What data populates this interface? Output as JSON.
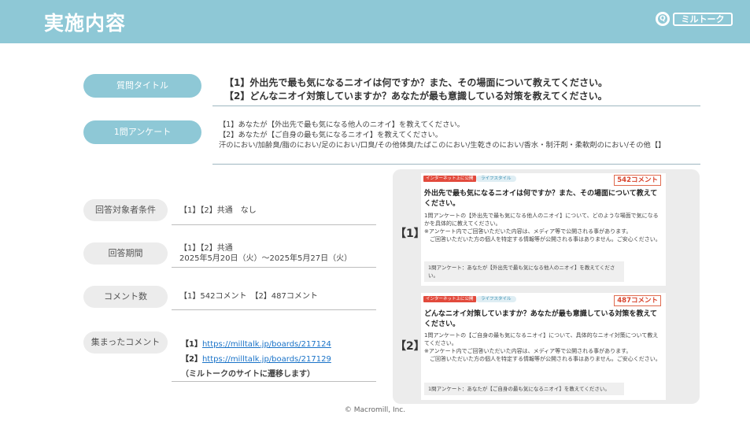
{
  "header": {
    "title": "実施内容",
    "logo_mark": "Q",
    "logo_text": "ミルトーク"
  },
  "labels": {
    "question_title": "質問タイトル",
    "survey": "1問アンケート",
    "target": "回答対象者条件",
    "period": "回答期間",
    "comments": "コメント数",
    "collected": "集まったコメント"
  },
  "question_title": {
    "line1": "【1】外出先で最も気になるニオイは何ですか？また、その場面について教えてください。",
    "line2": "【2】どんなニオイ対策していますか？あなたが最も意識している対策を教えてください。"
  },
  "survey": {
    "line1": "【1】あなたが【外出先で最も気になる他人のニオイ】を教えてください。",
    "line2": "【2】あなたが【ご自身の最も気になるニオイ】を教えてください。",
    "line3": "汗のにおい/加齢臭/脂のにおい/足のにおい/口臭/その他体臭/たばこのにおい/生乾きのにおい/香水・制汗剤・柔軟剤のにおい/その他【】"
  },
  "target_value": "【1】【2】共通　なし",
  "period": {
    "line1": "【1】【2】共通",
    "line2": "2025年5月20日（火）～2025年5月27日（火）"
  },
  "comments_value": "【1】542コメント　【2】487コメント",
  "collected": {
    "item1_label": "【1】",
    "item1_url": "https://milltalk.jp/boards/217124",
    "item2_label": "【2】",
    "item2_url": "https://milltalk.jp/boards/217129",
    "note": "（ミルトークのサイトに遷移します）"
  },
  "cards": [
    {
      "label": "【1】",
      "tag": "インターネット上に公開",
      "category": "ライフスタイル",
      "count": "542コメント",
      "heading": "外出先で最も気になるニオイは何ですか？また、その場面について教えてください。",
      "body1": "1問アンケートの【外出先で最も気になる他人のニオイ】について、どのような場面で気になるかを具体的に教えてください。",
      "body2": "※アンケート内でご回答いただいた内容は、メディア等で公開される事があります。",
      "body3": "　ご回答いただいた方の個人を特定する情報等が公開される事はありません。ご安心ください。",
      "poll": "1問アンケート：あなたが【外出先で最も気になる他人のニオイ】を教えてください。"
    },
    {
      "label": "【2】",
      "tag": "インターネット上に公開",
      "category": "ライフスタイル",
      "count": "487コメント",
      "heading": "どんなニオイ対策していますか？あなたが最も意識している対策を教えてください。",
      "body1": "1問アンケートの【ご自身の最も気になるニオイ】について、具体的なニオイ対策について教えてください。",
      "body2": "※アンケート内でご回答いただいた内容は、メディア等で公開される事があります。",
      "body3": "　ご回答いただいた方の個人を特定する情報等が公開される事はありません。ご安心ください。",
      "poll": "1問アンケート：あなたが【ご自身の最も気になるニオイ】を教えてください。"
    }
  ],
  "copyright": "© Macromill, Inc.",
  "colors": {
    "header": "#8ec8d6",
    "link": "#1a73c8",
    "accent_red": "#e24a3c"
  }
}
